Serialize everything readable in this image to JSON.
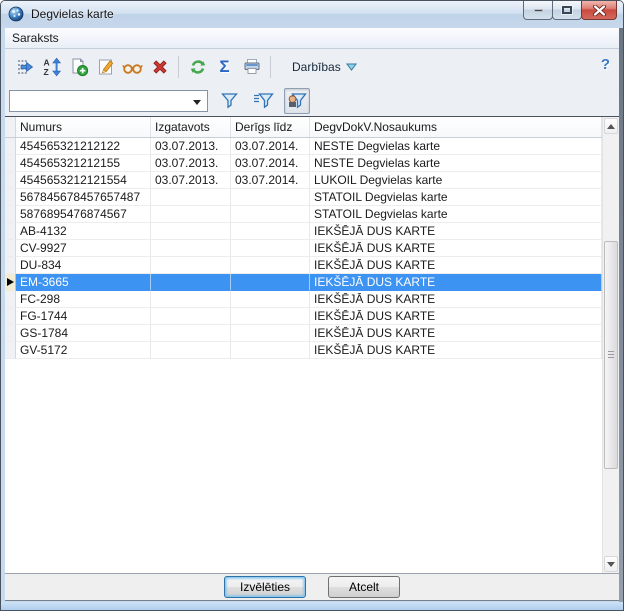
{
  "window": {
    "title": "Degvielas karte"
  },
  "menu": {
    "items": [
      "Saraksts"
    ]
  },
  "toolbar": {
    "icons": [
      "select-list-icon",
      "sort-az-icon",
      "add-document-icon",
      "edit-pencil-icon",
      "glasses-icon",
      "delete-x-icon",
      "refresh-icon",
      "sigma-icon",
      "printer-icon"
    ],
    "sigma_glyph": "Σ",
    "darbibas_label": "Darbības",
    "help_glyph": "?"
  },
  "filter": {
    "combobox_value": "",
    "buttons": [
      "filter-icon",
      "filter-advanced-icon",
      "filter-user-icon"
    ],
    "user_filter_pressed": true
  },
  "table": {
    "columns": [
      "Numurs",
      "Izgatavots",
      "Derīgs līdz",
      "DegvDokV.Nosaukums"
    ],
    "rows": [
      [
        "454565321212122",
        "03.07.2013.",
        "03.07.2014.",
        "NESTE Degvielas karte"
      ],
      [
        "454565321212155",
        "03.07.2013.",
        "03.07.2014.",
        "NESTE Degvielas karte"
      ],
      [
        "4545653212121554",
        "03.07.2013.",
        "03.07.2014.",
        "LUKOIL Degvielas karte"
      ],
      [
        "567845678457657487",
        "",
        "",
        "STATOIL Degvielas karte"
      ],
      [
        "5876895476874567",
        "",
        "",
        "STATOIL Degvielas karte"
      ],
      [
        "AB-4132",
        "",
        "",
        "IEKŠĒJĀ DUS KARTE"
      ],
      [
        "CV-9927",
        "",
        "",
        "IEKŠĒJĀ DUS KARTE"
      ],
      [
        "DU-834",
        "",
        "",
        "IEKŠĒJĀ DUS KARTE"
      ],
      [
        "EM-3665",
        "",
        "",
        "IEKŠĒJĀ DUS KARTE"
      ],
      [
        "FC-298",
        "",
        "",
        "IEKŠĒJĀ DUS KARTE"
      ],
      [
        "FG-1744",
        "",
        "",
        "IEKŠĒJĀ DUS KARTE"
      ],
      [
        "GS-1784",
        "",
        "",
        "IEKŠĒJĀ DUS KARTE"
      ],
      [
        "GV-5172",
        "",
        "",
        "IEKŠĒJĀ DUS KARTE"
      ]
    ],
    "selected_numurs": "EM-3665"
  },
  "footer": {
    "select_label": "Izvēlēties",
    "cancel_label": "Atcelt"
  },
  "colors": {
    "selection_bg": "#3D93F2",
    "selection_fg": "#FFFFFF",
    "close_button_red": "#C94A3F",
    "titlebar_blue": "#C8D8EC",
    "bottom_strip_blue": "#AECDEE"
  }
}
